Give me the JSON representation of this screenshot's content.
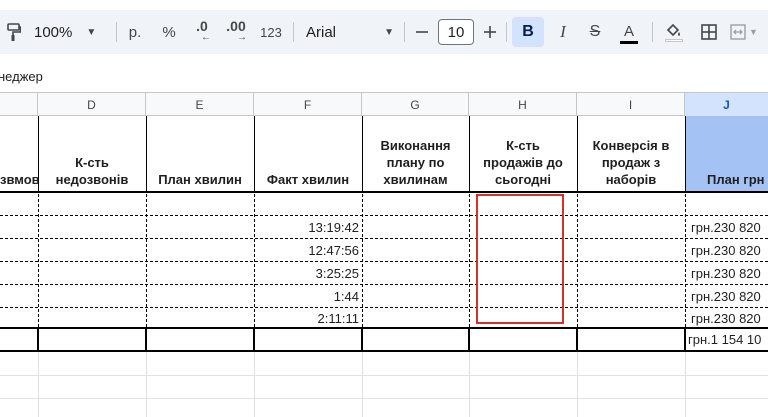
{
  "toolbar": {
    "zoom": "100%",
    "currency_label": "р.",
    "percent_label": "%",
    "decrease_decimal_label": ".0",
    "increase_decimal_label": ".00",
    "number_format_label": "123",
    "font_family": "Arial",
    "font_size": "10",
    "bold_label": "B",
    "italic_label": "I",
    "strike_label": "S",
    "text_color_label": "A"
  },
  "formula_bar": {
    "text": "неджер"
  },
  "columns": [
    "D",
    "E",
    "F",
    "G",
    "H",
    "I",
    "J"
  ],
  "selected_column": "J",
  "headers": {
    "c": "звмов",
    "d": "К-сть недозвонів",
    "e": "План хвилин",
    "f": "Факт хвилин",
    "g": "Виконання плану по хвилинам",
    "h": "К-сть продажів до сьогодні",
    "i": "Конверсія в продаж з наборів",
    "j": "План грн"
  },
  "rows": [
    {
      "f": "13:19:42",
      "j": "грн.230 820"
    },
    {
      "f": "12:47:56",
      "j": "грн.230 820"
    },
    {
      "f": "3:25:25",
      "j": "грн.230 820"
    },
    {
      "f": "1:44",
      "j": "грн.230 820"
    },
    {
      "f": "2:11:11",
      "j": "грн.230 820"
    }
  ],
  "total": {
    "j": "грн.1 154 10"
  },
  "colors": {
    "toolbar_bg": "#f0f4f9",
    "selected_col": "#d3e3fd",
    "highlight_border": "#d93025"
  }
}
